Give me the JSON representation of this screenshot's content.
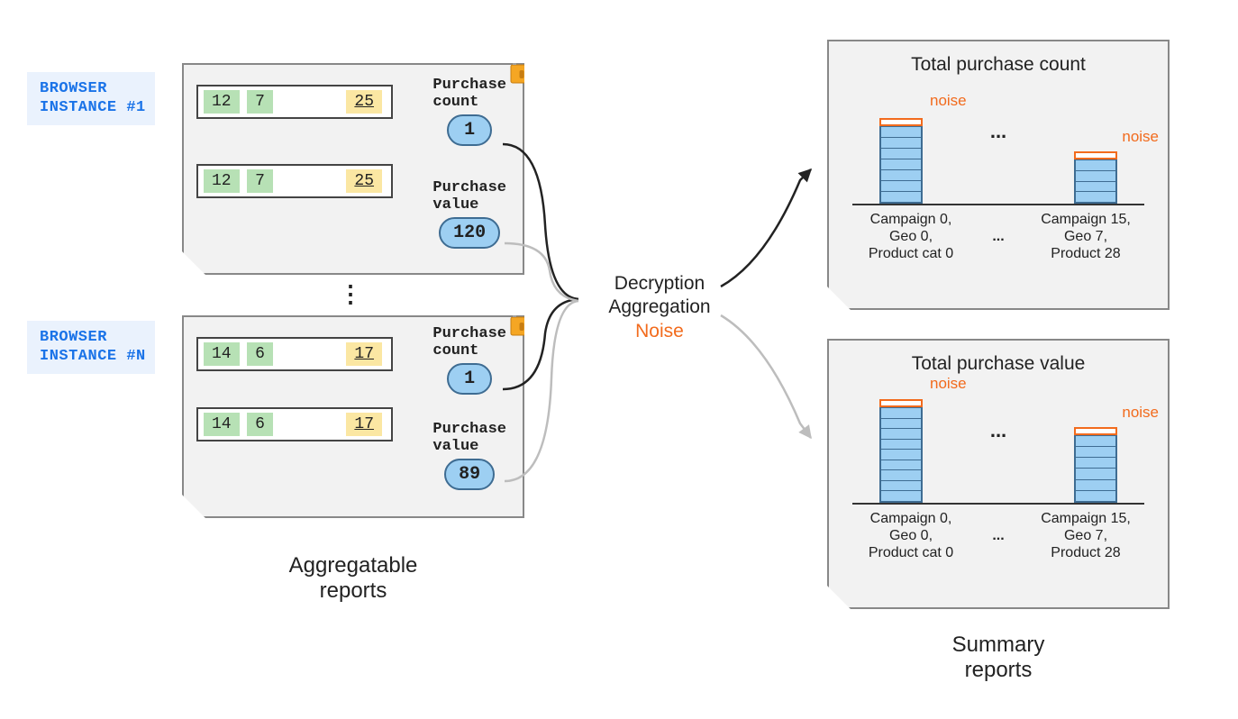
{
  "browser_labels": {
    "one": "BROWSER\nINSTANCE #1",
    "n": "BROWSER\nINSTANCE #N"
  },
  "reports": {
    "a": {
      "row1": {
        "k1": "12",
        "k2": "7",
        "k3": "25",
        "metric_label": "Purchase\ncount",
        "value": "1"
      },
      "row2": {
        "k1": "12",
        "k2": "7",
        "k3": "25",
        "metric_label": "Purchase\nvalue",
        "value": "120"
      }
    },
    "b": {
      "row1": {
        "k1": "14",
        "k2": "6",
        "k3": "17",
        "metric_label": "Purchase\ncount",
        "value": "1"
      },
      "row2": {
        "k1": "14",
        "k2": "6",
        "k3": "17",
        "metric_label": "Purchase\nvalue",
        "value": "89"
      }
    }
  },
  "center": {
    "l1": "Decryption",
    "l2": "Aggregation",
    "l3": "Noise"
  },
  "chart_data": [
    {
      "type": "bar",
      "title": "Total purchase count",
      "noise_label": "noise",
      "categories": [
        "Campaign 0,\nGeo 0,\nProduct cat 0",
        "Campaign 15,\nGeo 7,\nProduct 28"
      ],
      "values": [
        90,
        55
      ],
      "has_ellipsis": true
    },
    {
      "type": "bar",
      "title": "Total purchase value",
      "noise_label": "noise",
      "categories": [
        "Campaign 0,\nGeo 0,\nProduct cat 0",
        "Campaign 15,\nGeo 7,\nProduct 28"
      ],
      "values": [
        110,
        80
      ],
      "has_ellipsis": true
    }
  ],
  "ellipsis": "...",
  "section_labels": {
    "left": "Aggregatable\nreports",
    "right": "Summary\nreports"
  },
  "colors": {
    "orange": "#f26b1d",
    "blue": "#9dcff2",
    "green": "#b7e1b5",
    "yellow": "#fbe7a3"
  }
}
